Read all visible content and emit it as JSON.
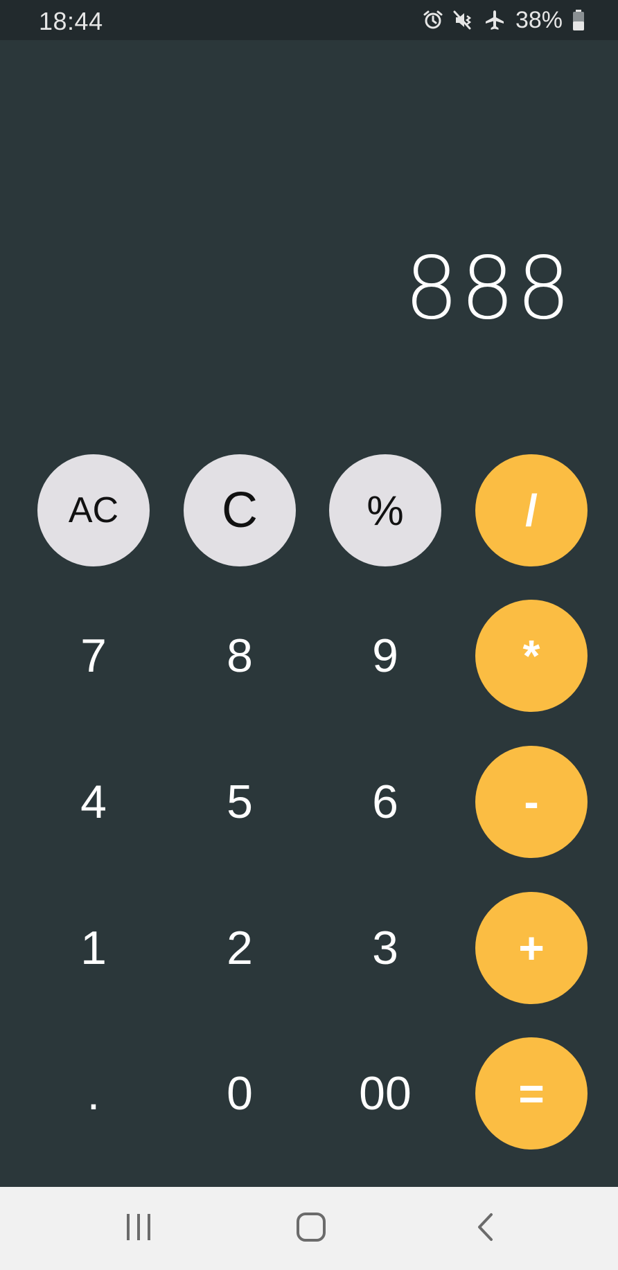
{
  "status_bar": {
    "time": "18:44",
    "battery_percent": "38%",
    "icons": [
      "alarm-icon",
      "vibrate-mute-icon",
      "airplane-mode-icon",
      "battery-icon"
    ]
  },
  "display": {
    "value": "888"
  },
  "keys": {
    "ac": "AC",
    "clear": "C",
    "percent": "%",
    "divide": "/",
    "seven": "7",
    "eight": "8",
    "nine": "9",
    "multiply": "*",
    "four": "4",
    "five": "5",
    "six": "6",
    "subtract": "-",
    "one": "1",
    "two": "2",
    "three": "3",
    "add": "+",
    "decimal": ".",
    "zero": "0",
    "double_zero": "00",
    "equals": "="
  },
  "nav_bar": {
    "icons": [
      "recents-icon",
      "home-icon",
      "back-icon"
    ]
  },
  "colors": {
    "background": "#2b373a",
    "status_bar": "#222a2d",
    "function_key": "#e2e0e4",
    "operator_key": "#fbbd43",
    "nav_bar": "#f1f1f1"
  }
}
